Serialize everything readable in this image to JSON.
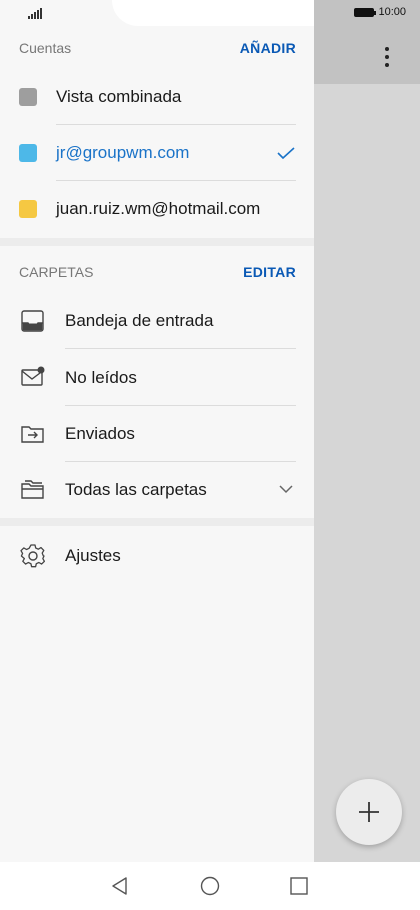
{
  "status": {
    "time": "10:00"
  },
  "accounts": {
    "header": "Cuentas",
    "add_label": "AÑADIR",
    "items": [
      {
        "label": "Vista combinada",
        "color": "#9e9e9e"
      },
      {
        "label": "jr@groupwm.com",
        "color": "#4db8e8",
        "selected": true
      },
      {
        "label": "juan.ruiz.wm@hotmail.com",
        "color": "#f5c842"
      }
    ]
  },
  "folders": {
    "header": "CARPETAS",
    "edit_label": "EDITAR",
    "items": [
      {
        "label": "Bandeja de entrada",
        "icon": "inbox-icon"
      },
      {
        "label": "No leídos",
        "icon": "unread-mail-icon"
      },
      {
        "label": "Enviados",
        "icon": "sent-folder-icon"
      },
      {
        "label": "Todas las carpetas",
        "icon": "all-folders-icon"
      }
    ]
  },
  "settings": {
    "label": "Ajustes",
    "icon": "gear-icon"
  },
  "colors": {
    "accent": "#0a59b5",
    "selected_text": "#1a73c8"
  }
}
